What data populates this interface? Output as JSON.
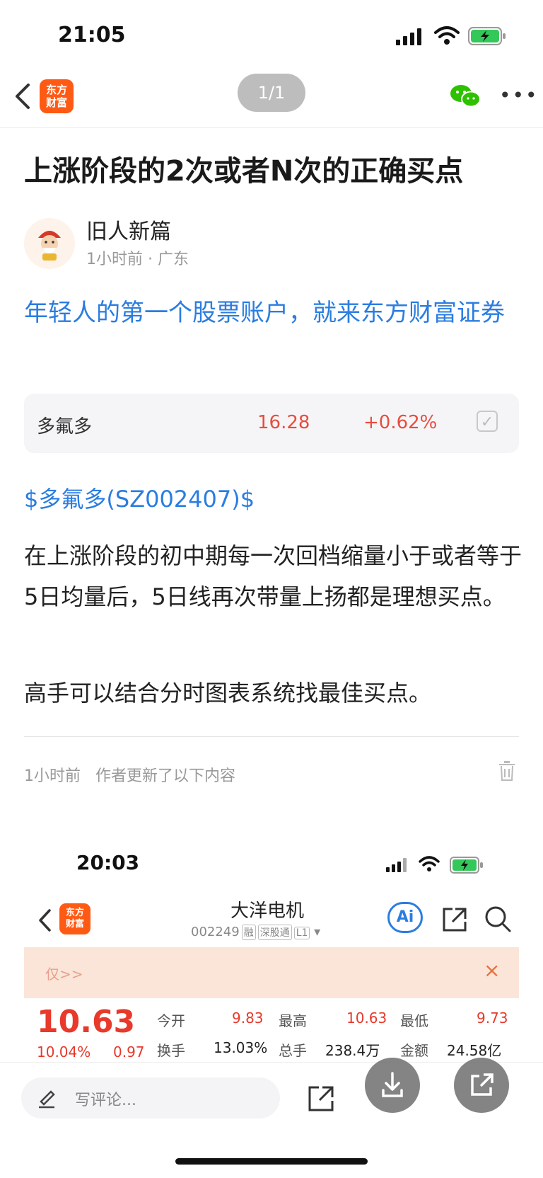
{
  "status_bar": {
    "time": "21:05"
  },
  "nav": {
    "logo_line1": "东方",
    "logo_line2": "财富",
    "pager": "1/1"
  },
  "article": {
    "title": "上涨阶段的2次或者N次的正确买点",
    "author": "旧人新篇",
    "meta": "1小时前 · 广东",
    "promo": "年轻人的第一个股票账户，就来东方财富证券",
    "stock_card": {
      "name": "多氟多",
      "price": "16.28",
      "change": "+0.62%"
    },
    "tag": "$多氟多(SZ002407)$",
    "paragraph1": "在上涨阶段的初中期每一次回档缩量小于或者等于5日均量后，5日线再次带量上扬都是理想买点。",
    "paragraph2": "高手可以结合分时图表系统找最佳买点。",
    "update_time": "1小时前",
    "update_text": "作者更新了以下内容"
  },
  "embedded": {
    "time": "20:03",
    "logo_line1": "东方",
    "logo_line2": "财富",
    "stock_name": "大洋电机",
    "stock_code": "002249",
    "badges": [
      "融",
      "深股通",
      "L1"
    ],
    "ai_label": "Ai",
    "banner_text": "仅>>",
    "banner_close": "×",
    "price": "10.63",
    "pct_change": "10.04%",
    "abs_change": "0.97",
    "quotes": [
      {
        "label": "今开",
        "value": "9.83"
      },
      {
        "label": "最高",
        "value": "10.63"
      },
      {
        "label": "最低",
        "value": "9.73"
      },
      {
        "label": "换手",
        "value": "13.03%"
      },
      {
        "label": "总手",
        "value": "238.4万"
      },
      {
        "label": "金额",
        "value": "24.58亿"
      }
    ]
  },
  "bottom_bar": {
    "comment_placeholder": "写评论..."
  },
  "colors": {
    "accent_blue": "#2a7de1",
    "up_red": "#e8392b",
    "brand_orange": "#ff5a14"
  }
}
